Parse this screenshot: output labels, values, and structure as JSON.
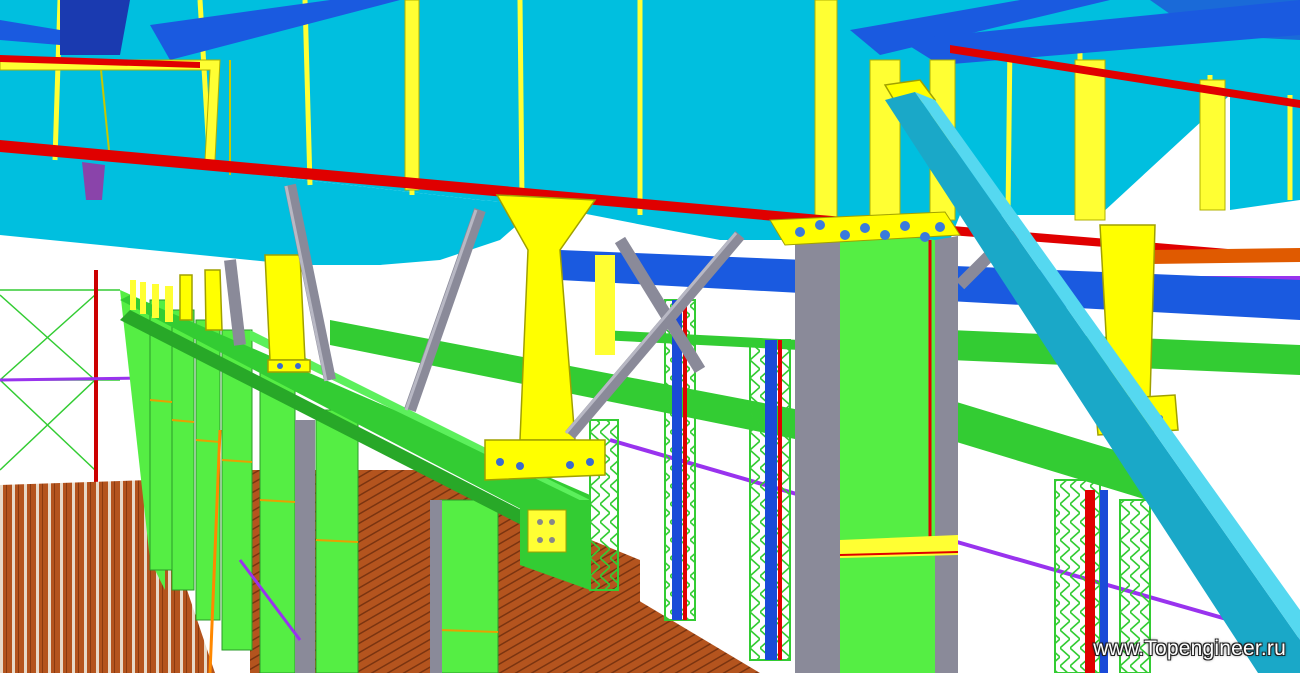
{
  "watermark": {
    "text": "www.Topengineer.ru"
  },
  "palette": {
    "roof_panel": "#00bfdf",
    "roof_purlin": "#ffff33",
    "main_beam_blue": "#1448e0",
    "red_rail": "#e00000",
    "green_beam": "#33cc33",
    "light_green_column": "#55ee44",
    "grey_column": "#8a8a99",
    "yellow_bracket": "#ffff00",
    "diagonal_brace": "#1aa8c8",
    "deck_wood": "#b4541e",
    "purple_rail": "#9933ee",
    "orange_rail": "#ff8800"
  },
  "scene": {
    "description_tag": "steel-frame-3d-model",
    "watermark_position": "bottom-right"
  }
}
